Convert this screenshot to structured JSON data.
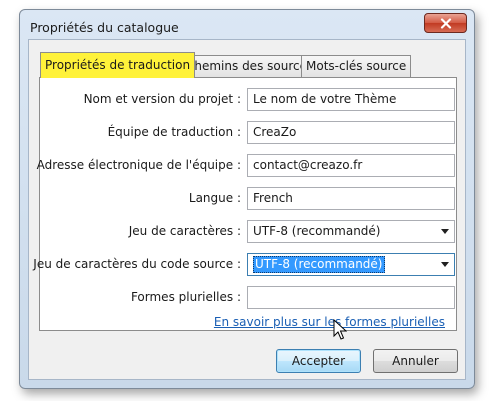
{
  "dialog": {
    "title": "Propriétés du catalogue",
    "close_icon": "close-icon"
  },
  "tabs": [
    {
      "label": "Propriétés de traduction",
      "active": true
    },
    {
      "label": "Chemins des sources",
      "active": false
    },
    {
      "label": "Mots-clés source",
      "active": false
    }
  ],
  "form": {
    "project_name": {
      "label": "Nom et version du projet :",
      "value": "Le nom de votre Thème"
    },
    "team": {
      "label": "Équipe de traduction :",
      "value": "CreaZo"
    },
    "team_email": {
      "label": "Adresse électronique de l'équipe :",
      "value": "contact@creazo.fr"
    },
    "language": {
      "label": "Langue :",
      "value": "French"
    },
    "charset": {
      "label": "Jeu de caractères :",
      "value": "UTF-8 (recommandé)"
    },
    "source_charset": {
      "label": "Jeu de caractères du code source :",
      "value": "UTF-8 (recommandé)"
    },
    "plural_forms": {
      "label": "Formes plurielles :",
      "value": ""
    },
    "plural_link": "En savoir plus sur les formes plurielles"
  },
  "buttons": {
    "accept": "Accepter",
    "cancel": "Annuler"
  },
  "colors": {
    "active_tab_highlight": "#fff23a",
    "selection": "#3399ff",
    "close_button": "#c13a22",
    "link": "#1a5fb4"
  }
}
